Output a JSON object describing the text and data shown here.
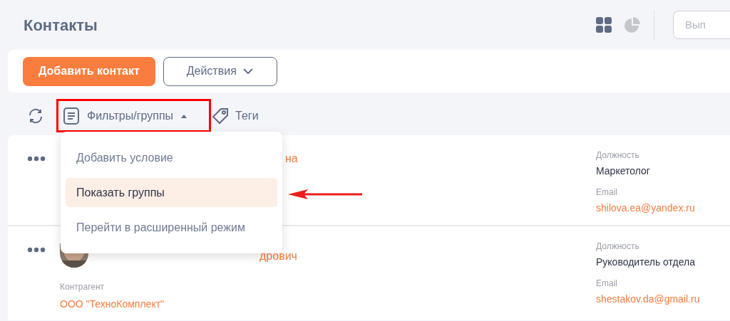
{
  "header": {
    "title": "Контакты",
    "search": {
      "placeholder": "Вып"
    }
  },
  "actions": {
    "add_button": "Добавить контакт",
    "actions_button": "Действия"
  },
  "toolbar": {
    "filters_button": "Фильтры/группы",
    "filters_expanded": true,
    "tags_button": "Теги"
  },
  "filters_menu": [
    {
      "label": "Добавить условие",
      "selected": false
    },
    {
      "label": "Показать группы",
      "selected": true
    },
    {
      "label": "Перейти в расширенный режим",
      "selected": false
    }
  ],
  "contacts": [
    {
      "name_visible": "на",
      "position_label": "Должность",
      "position": "Маркетолог",
      "email_label": "Email",
      "email": "shilova.ea@yandex.ru"
    },
    {
      "name_visible": "дрович",
      "counterparty_label": "Контрагент",
      "counterparty": "ООО \"ТехноКомплект\"",
      "position_label": "Должность",
      "position": "Руководитель отдела",
      "email_label": "Email",
      "email": "shestakov.da@gmail.ru"
    }
  ]
}
